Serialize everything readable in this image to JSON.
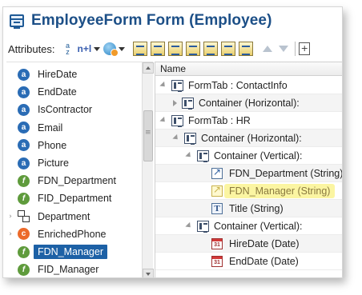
{
  "window": {
    "title": "EmployeeForm Form (Employee)"
  },
  "toolbar": {
    "attributes_label": "Attributes:",
    "sort_top": "a",
    "sort_bottom": "z",
    "newline_label": "n+l",
    "plus_label": "+"
  },
  "attributes": {
    "items": [
      {
        "label": "HireDate",
        "kind": "attribute",
        "expander": ""
      },
      {
        "label": "EndDate",
        "kind": "attribute",
        "expander": ""
      },
      {
        "label": "IsContractor",
        "kind": "attribute",
        "expander": ""
      },
      {
        "label": "Email",
        "kind": "attribute",
        "expander": ""
      },
      {
        "label": "Phone",
        "kind": "attribute",
        "expander": ""
      },
      {
        "label": "Picture",
        "kind": "attribute",
        "expander": ""
      },
      {
        "label": "FDN_Department",
        "kind": "function",
        "expander": ""
      },
      {
        "label": "FID_Department",
        "kind": "function",
        "expander": ""
      },
      {
        "label": "Department",
        "kind": "entity",
        "expander": "›"
      },
      {
        "label": "EnrichedPhone",
        "kind": "enriched",
        "expander": "›"
      },
      {
        "label": "FDN_Manager",
        "kind": "function",
        "expander": "",
        "selected": true
      },
      {
        "label": "FID_Manager",
        "kind": "function",
        "expander": ""
      }
    ],
    "icon_letters": {
      "attribute": "a",
      "function": "f",
      "enriched": "c"
    }
  },
  "form_tree": {
    "column_header": "Name",
    "rows": [
      {
        "label": "FormTab : ContactInfo",
        "icon": "container",
        "expand": "open"
      },
      {
        "label": "Container (Horizontal):",
        "icon": "container",
        "expand": "closed"
      },
      {
        "label": "FormTab : HR",
        "icon": "container",
        "expand": "open"
      },
      {
        "label": "Container (Horizontal):",
        "icon": "container",
        "expand": "open"
      },
      {
        "label": "Container (Vertical):",
        "icon": "container",
        "expand": "open"
      },
      {
        "label": "FDN_Department (String)",
        "icon": "link",
        "expand": ""
      },
      {
        "label": "FDN_Manager (String)",
        "icon": "link",
        "expand": "",
        "highlighted": true
      },
      {
        "label": "Title (String)",
        "icon": "text",
        "expand": ""
      },
      {
        "label": "Container (Vertical):",
        "icon": "container",
        "expand": "open"
      },
      {
        "label": "HireDate (Date)",
        "icon": "date",
        "expand": ""
      },
      {
        "label": "EndDate (Date)",
        "icon": "date",
        "expand": ""
      }
    ],
    "text_icon_letter": "T",
    "date_icon_text": "31"
  },
  "colors": {
    "title": "#1c4f87",
    "selection": "#1d61a6",
    "highlight": "#fbf5a2",
    "attribute_icon": "#2a6cb5",
    "function_icon": "#5f9b3c",
    "enriched_icon": "#ec6a2a"
  }
}
